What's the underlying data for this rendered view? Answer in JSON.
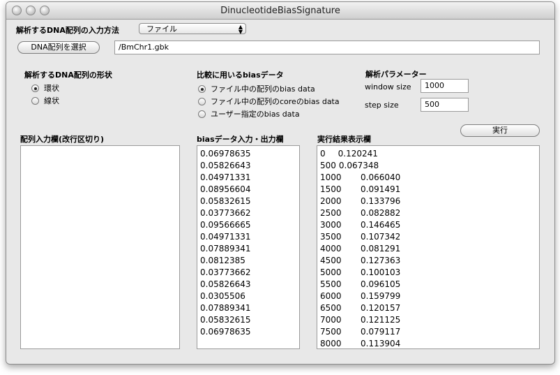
{
  "window": {
    "title": "DinucleotideBiasSignature"
  },
  "input_method": {
    "label": "解析するDNA配列の入力方法",
    "selected": "ファイル"
  },
  "select_button": {
    "label": "DNA配列を選択"
  },
  "file_path": {
    "value": "/BmChr1.gbk"
  },
  "shape": {
    "label": "解析するDNA配列の形状",
    "options": [
      {
        "label": "環状",
        "selected": true
      },
      {
        "label": "線状",
        "selected": false
      }
    ]
  },
  "bias_source": {
    "label": "比較に用いるbiasデータ",
    "options": [
      {
        "label": "ファイル中の配列のbias data",
        "selected": true
      },
      {
        "label": "ファイル中の配列のcoreのbias data",
        "selected": false
      },
      {
        "label": "ユーザー指定のbias data",
        "selected": false
      }
    ]
  },
  "params": {
    "label": "解析パラメーター",
    "window_size": {
      "label": "window size",
      "value": "1000"
    },
    "step_size": {
      "label": "step size",
      "value": "500"
    }
  },
  "run_button": {
    "label": "実行"
  },
  "sequence_input": {
    "label": "配列入力欄(改行区切り)",
    "value": ""
  },
  "bias_io": {
    "label": "biasデータ入力・出力欄",
    "values": [
      "0.06978635",
      "0.05826643",
      "0.04971331",
      "0.08956604",
      "0.05832615",
      "0.03773662",
      "0.09566665",
      "0.04971331",
      "0.07889341",
      "0.0812385",
      "0.03773662",
      "0.05826643",
      "0.0305506",
      "0.07889341",
      "0.05832615",
      "0.06978635"
    ]
  },
  "results": {
    "label": "実行結果表示欄",
    "rows": [
      {
        "pos": "0",
        "val": "0.120241",
        "compact": true
      },
      {
        "pos": "500",
        "val": "0.067348",
        "compact": true
      },
      {
        "pos": "1000",
        "val": "0.066040"
      },
      {
        "pos": "1500",
        "val": "0.091491"
      },
      {
        "pos": "2000",
        "val": "0.133796"
      },
      {
        "pos": "2500",
        "val": "0.082882"
      },
      {
        "pos": "3000",
        "val": "0.146465"
      },
      {
        "pos": "3500",
        "val": "0.107342"
      },
      {
        "pos": "4000",
        "val": "0.081291"
      },
      {
        "pos": "4500",
        "val": "0.127363"
      },
      {
        "pos": "5000",
        "val": "0.100103"
      },
      {
        "pos": "5500",
        "val": "0.096105"
      },
      {
        "pos": "6000",
        "val": "0.159799"
      },
      {
        "pos": "6500",
        "val": "0.120157"
      },
      {
        "pos": "7000",
        "val": "0.121125"
      },
      {
        "pos": "7500",
        "val": "0.079117"
      },
      {
        "pos": "8000",
        "val": "0.113904"
      }
    ]
  }
}
